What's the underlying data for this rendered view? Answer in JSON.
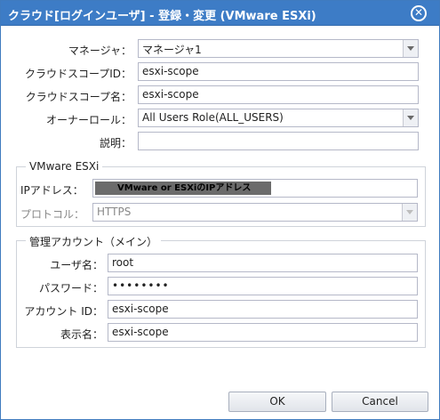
{
  "dialog": {
    "title": "クラウド[ログインユーザ] - 登録・変更 (VMware ESXi)",
    "close_glyph": "✕",
    "icon_names": [
      "close-icon",
      "chevron-down-icon"
    ]
  },
  "form": {
    "manager": {
      "label": "マネージャ：",
      "value": "マネージャ1"
    },
    "scope_id": {
      "label": "クラウドスコープID：",
      "value": "esxi-scope"
    },
    "scope_name": {
      "label": "クラウドスコープ名：",
      "value": "esxi-scope"
    },
    "owner_role": {
      "label": "オーナーロール：",
      "value": "All Users Role(ALL_USERS)"
    },
    "description": {
      "label": "説明：",
      "value": ""
    }
  },
  "vmware": {
    "legend": "VMware ESXi",
    "ip": {
      "label": "IPアドレス：",
      "value": "VMware or ESXiのIPアドレス"
    },
    "protocol": {
      "label": "プロトコル：",
      "value": "HTTPS"
    }
  },
  "account": {
    "legend": "管理アカウント（メイン）",
    "user": {
      "label": "ユーザ名：",
      "value": "root"
    },
    "password": {
      "label": "パスワード：",
      "value": "••••••••"
    },
    "account_id": {
      "label": "アカウント ID：",
      "value": "esxi-scope"
    },
    "display_name": {
      "label": "表示名：",
      "value": "esxi-scope"
    }
  },
  "buttons": {
    "ok": "OK",
    "cancel": "Cancel"
  },
  "colors": {
    "titlebar": "#3d7cc6",
    "border": "#b5b8c8"
  }
}
